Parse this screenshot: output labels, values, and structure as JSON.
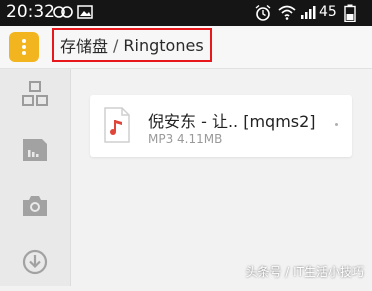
{
  "status_bar": {
    "time": "20:32",
    "battery": "45",
    "icons": [
      "infinity-icon",
      "image-icon",
      "alarm-icon",
      "wifi-icon",
      "signal-icon",
      "battery-icon"
    ]
  },
  "breadcrumb": {
    "root": "存储盘",
    "separator": "/",
    "current": "Ringtones"
  },
  "sidebar": {
    "items": [
      {
        "icon": "category-icon"
      },
      {
        "icon": "sd-card-icon"
      },
      {
        "icon": "camera-icon"
      },
      {
        "icon": "download-icon"
      }
    ]
  },
  "files": [
    {
      "name": "倪安东 - 让.. [mqms2]",
      "meta": "MP3 4.11MB",
      "icon": "music-file-icon"
    }
  ],
  "watermark": "头条号 / IT生活小技巧",
  "colors": {
    "accent": "#f3b51f",
    "highlight": "#e8171c",
    "music": "#e0453a"
  }
}
